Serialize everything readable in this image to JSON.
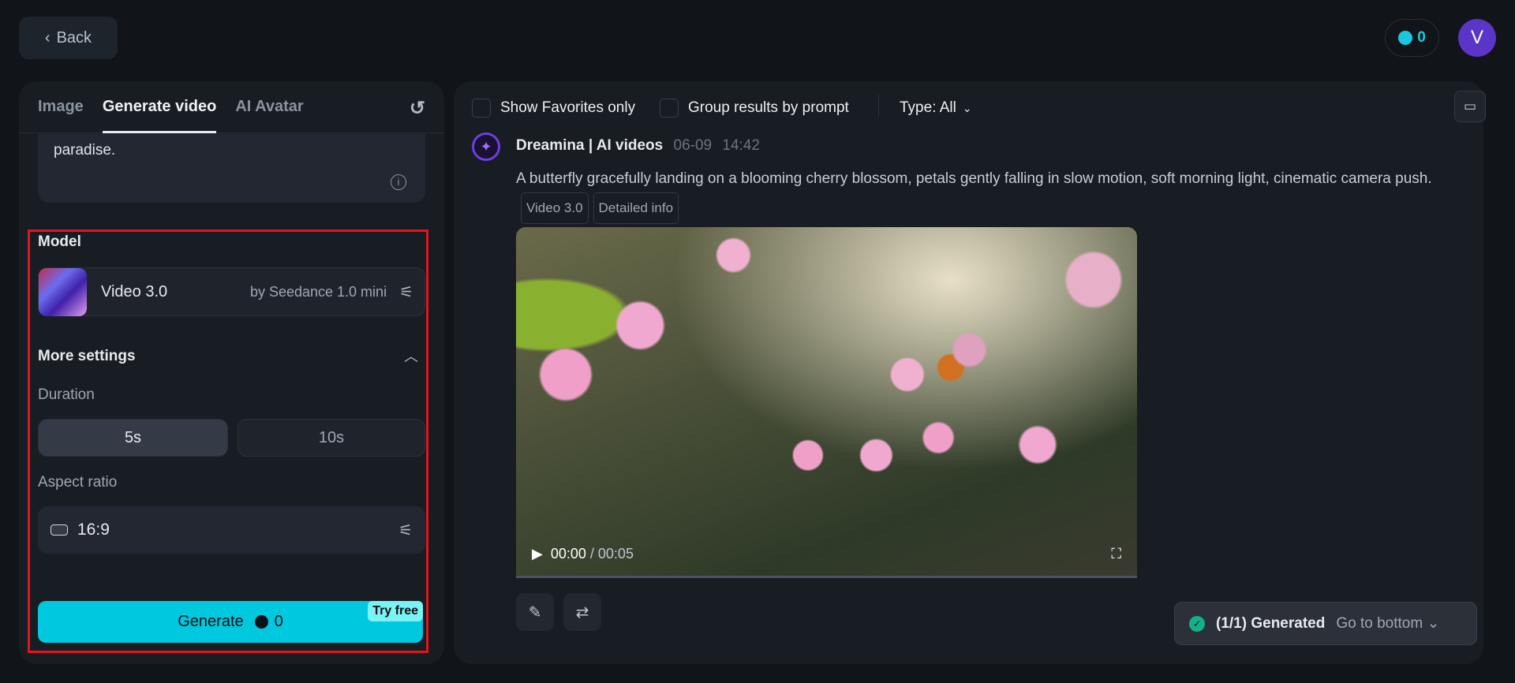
{
  "header": {
    "back_label": "Back",
    "credits": "0",
    "avatar_initial": "V"
  },
  "left_panel": {
    "tabs": [
      {
        "label": "Image"
      },
      {
        "label": "Generate video"
      },
      {
        "label": "AI Avatar"
      }
    ],
    "prompt_tail": "paradise.",
    "model_label": "Model",
    "model": {
      "name": "Video 3.0",
      "provider": "by Seedance 1.0 mini"
    },
    "more_settings_label": "More settings",
    "duration_label": "Duration",
    "durations": [
      "5s",
      "10s"
    ],
    "aspect_ratio_label": "Aspect ratio",
    "aspect_ratio": "16:9",
    "generate_label": "Generate",
    "generate_cost": "0",
    "try_free_label": "Try free"
  },
  "right_panel": {
    "show_favorites_label": "Show Favorites only",
    "group_results_label": "Group results by prompt",
    "type_filter": "Type: All",
    "result": {
      "author": "Dreamina | AI videos",
      "date": "06-09",
      "time": "14:42",
      "prompt": "A butterfly gracefully landing on a blooming cherry blossom, petals gently falling in slow motion, soft morning light, cinematic camera push.",
      "chips": [
        "Video 3.0",
        "Detailed info"
      ],
      "current_time": "00:00",
      "duration": "/ 00:05",
      "progress": 0
    },
    "status": {
      "generated": "(1/1) Generated",
      "go_to_bottom": "Go to bottom"
    }
  }
}
